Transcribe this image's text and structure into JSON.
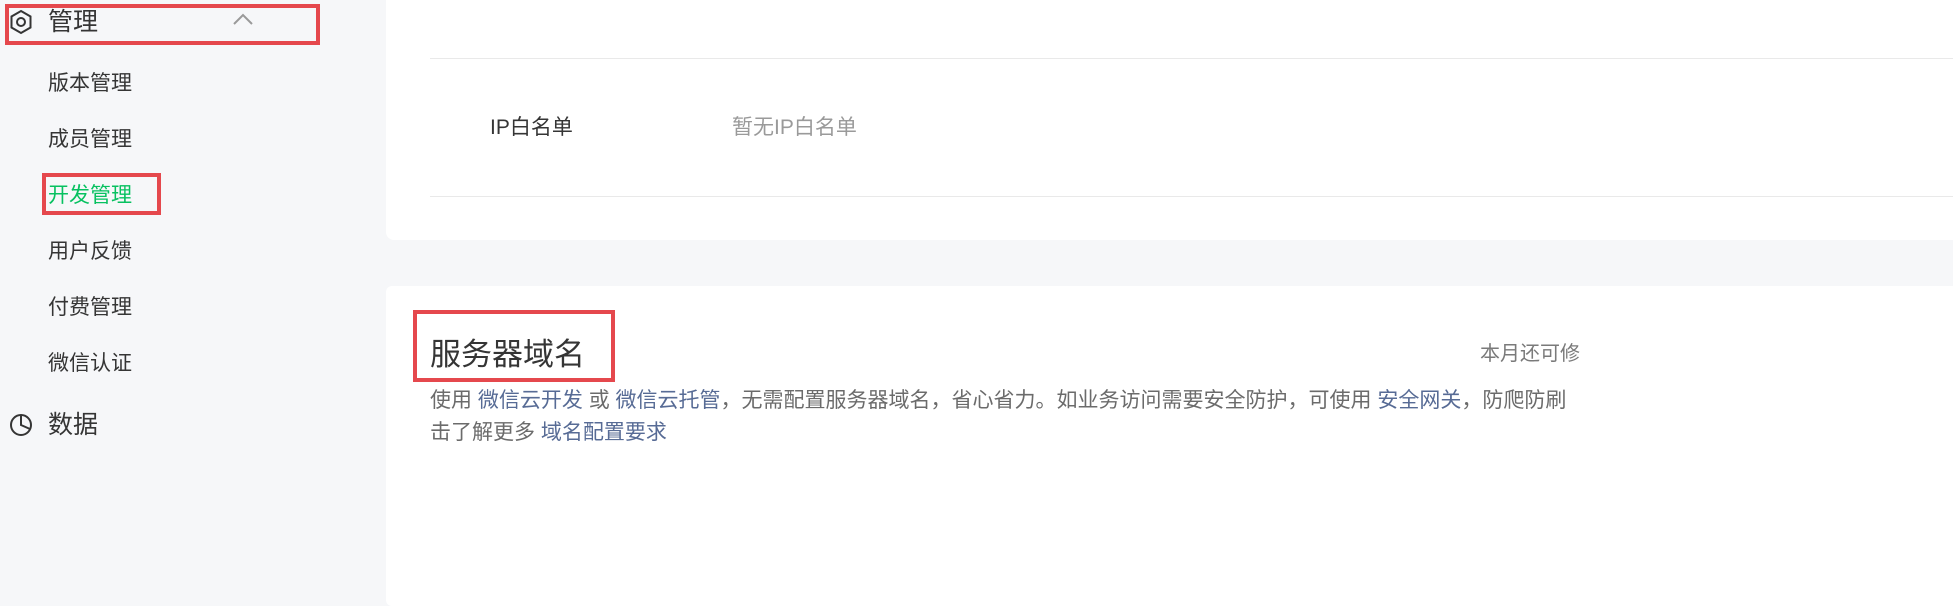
{
  "sidebar": {
    "manage_section": {
      "label": "管理",
      "icon": "settings-hexagon-icon",
      "expanded": true
    },
    "items": [
      {
        "label": "版本管理",
        "active": false
      },
      {
        "label": "成员管理",
        "active": false
      },
      {
        "label": "开发管理",
        "active": true
      },
      {
        "label": "用户反馈",
        "active": false
      },
      {
        "label": "付费管理",
        "active": false
      },
      {
        "label": "微信认证",
        "active": false
      }
    ],
    "data_section": {
      "label": "数据",
      "icon": "pie-chart-icon"
    }
  },
  "top_card": {
    "ip_whitelist": {
      "label": "IP白名单",
      "value": "暂无IP白名单"
    }
  },
  "server_domain": {
    "title": "服务器域名",
    "quota": "本月还可修",
    "desc": {
      "prefix": "使用",
      "link1": "微信云开发",
      "or": "或",
      "link2": "微信云托管",
      "middle": "，无需配置服务器域名，省心省力。如业务访问需要安全防护，可使用",
      "link3": "安全网关",
      "suffix": "，防爬防刷",
      "line2_prefix": "击了解更多",
      "link4": "域名配置要求"
    }
  },
  "colors": {
    "accent_green": "#07c160",
    "link_blue": "#576b95",
    "highlight_red": "#e5484d"
  }
}
